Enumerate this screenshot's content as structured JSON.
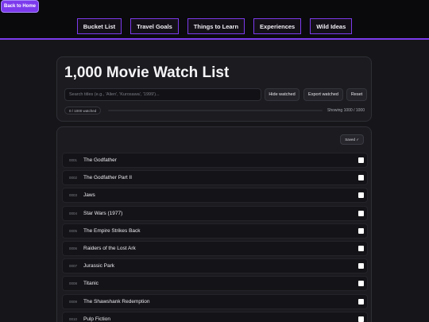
{
  "back_button": "Back to Home",
  "nav": [
    "Bucket List",
    "Travel Goals",
    "Things to Learn",
    "Experiences",
    "Wild Ideas"
  ],
  "header": {
    "title": "1,000 Movie Watch List",
    "search_placeholder": "Search titles (e.g., 'Alien', 'Kurosawa', '1999')...",
    "hide_watched": "Hide watched",
    "export_watched": "Export watched",
    "reset": "Reset",
    "watched_count": "0 / 1000 watched",
    "progress_fraction": 0,
    "showing": "Showing 1000 / 1000"
  },
  "list": {
    "saved_label": "Saved ✓",
    "movies": [
      {
        "num": "0001",
        "title": "The Godfather"
      },
      {
        "num": "0002",
        "title": "The Godfather Part II"
      },
      {
        "num": "0003",
        "title": "Jaws"
      },
      {
        "num": "0004",
        "title": "Star Wars (1977)"
      },
      {
        "num": "0005",
        "title": "The Empire Strikes Back"
      },
      {
        "num": "0006",
        "title": "Raiders of the Lost Ark"
      },
      {
        "num": "0007",
        "title": "Jurassic Park"
      },
      {
        "num": "0008",
        "title": "Titanic"
      },
      {
        "num": "0009",
        "title": "The Shawshank Redemption"
      },
      {
        "num": "0010",
        "title": "Pulp Fiction"
      }
    ]
  }
}
